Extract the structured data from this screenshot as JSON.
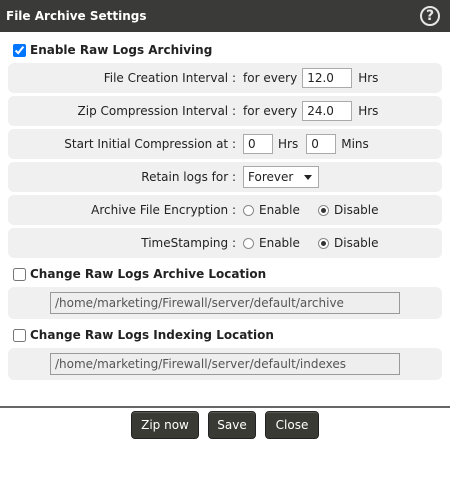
{
  "dialog": {
    "title": "File Archive Settings",
    "help_symbol": "?"
  },
  "enable_archiving": {
    "label": "Enable Raw Logs Archiving",
    "checked": true
  },
  "settings": {
    "file_creation": {
      "label": "File Creation Interval :",
      "prefix": "for every",
      "value": "12.0",
      "unit": "Hrs"
    },
    "zip_compression": {
      "label": "Zip Compression Interval :",
      "prefix": "for every",
      "value": "24.0",
      "unit": "Hrs"
    },
    "start_compression": {
      "label": "Start Initial Compression at :",
      "hrs_value": "0",
      "hrs_unit": "Hrs",
      "mins_value": "0",
      "mins_unit": "Mins"
    },
    "retain_logs": {
      "label": "Retain logs for :",
      "selected": "Forever"
    },
    "encryption": {
      "label": "Archive File Encryption :",
      "enable_label": "Enable",
      "disable_label": "Disable",
      "selected": "Disable"
    },
    "timestamping": {
      "label": "TimeStamping :",
      "enable_label": "Enable",
      "disable_label": "Disable",
      "selected": "Disable"
    }
  },
  "archive_location": {
    "label": "Change Raw Logs Archive Location",
    "checked": false,
    "path": "/home/marketing/Firewall/server/default/archive"
  },
  "indexing_location": {
    "label": "Change Raw Logs Indexing Location",
    "checked": false,
    "path": "/home/marketing/Firewall/server/default/indexes"
  },
  "buttons": {
    "zip_now": "Zip now",
    "save": "Save",
    "close": "Close"
  }
}
